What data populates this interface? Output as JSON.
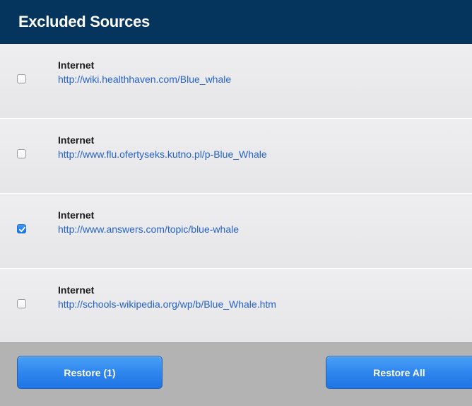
{
  "header": {
    "title": "Excluded Sources"
  },
  "sources": [
    {
      "type": "Internet",
      "url": "http://wiki.healthhaven.com/Blue_whale",
      "checked": false
    },
    {
      "type": "Internet",
      "url": "http://www.flu.ofertyseks.kutno.pl/p-Blue_Whale",
      "checked": false
    },
    {
      "type": "Internet",
      "url": "http://www.answers.com/topic/blue-whale",
      "checked": true
    },
    {
      "type": "Internet",
      "url": "http://schools-wikipedia.org/wp/b/Blue_Whale.htm",
      "checked": false
    }
  ],
  "footer": {
    "restore_label": "Restore (1)",
    "restore_all_label": "Restore All"
  },
  "colors": {
    "header_bg": "#05345c",
    "link": "#2563c9",
    "button": "#2f86ee"
  }
}
